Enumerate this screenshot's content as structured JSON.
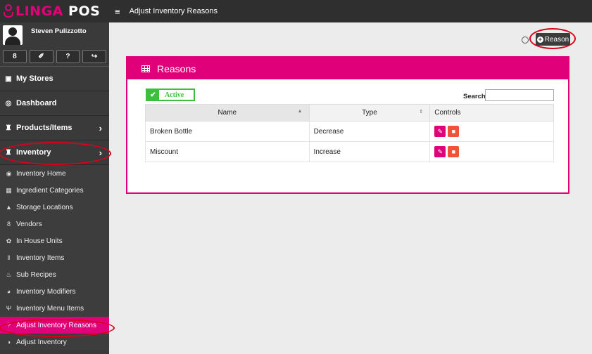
{
  "app": {
    "logo_part1": "LINGA",
    "logo_part2": "POS"
  },
  "user": {
    "name": "Steven Pulizzotto",
    "actions": [
      {
        "icon": "user-icon",
        "glyph": "8"
      },
      {
        "icon": "wrench-icon",
        "glyph": "✐"
      },
      {
        "icon": "help-icon",
        "glyph": "?"
      },
      {
        "icon": "logout-icon",
        "glyph": "↪"
      }
    ]
  },
  "sidebar": {
    "main_items": [
      {
        "label": "My Stores",
        "icon": "store-icon",
        "glyph": "▣"
      },
      {
        "label": "Dashboard",
        "icon": "dashboard-icon",
        "glyph": "◎"
      },
      {
        "label": "Products/Items",
        "icon": "products-icon",
        "glyph": "♜",
        "chevron": "›"
      },
      {
        "label": "Inventory",
        "icon": "inventory-icon",
        "glyph": "♜",
        "chevron": "›"
      }
    ],
    "sub_items": [
      {
        "label": "Inventory Home",
        "icon": "home-icon",
        "glyph": "◉"
      },
      {
        "label": "Ingredient Categories",
        "icon": "categories-icon",
        "glyph": "▦"
      },
      {
        "label": "Storage Locations",
        "icon": "flask-icon",
        "glyph": "▲"
      },
      {
        "label": "Vendors",
        "icon": "vendor-icon",
        "glyph": "8"
      },
      {
        "label": "In House Units",
        "icon": "units-icon",
        "glyph": "✿"
      },
      {
        "label": "Inventory Items",
        "icon": "items-icon",
        "glyph": "‖"
      },
      {
        "label": "Sub Recipes",
        "icon": "recipes-icon",
        "glyph": "♨"
      },
      {
        "label": "Inventory Modifiers",
        "icon": "modifiers-icon",
        "glyph": "◕"
      },
      {
        "label": "Inventory Menu Items",
        "icon": "menu-items-icon",
        "glyph": "Ψ"
      },
      {
        "label": "Adjust Inventory Reasons",
        "icon": "question-icon",
        "glyph": "?",
        "active": true
      },
      {
        "label": "Adjust Inventory",
        "icon": "adjust-icon",
        "glyph": "◑"
      }
    ]
  },
  "topbar": {
    "menu_glyph": "≡",
    "title": "Adjust Inventory Reasons"
  },
  "toolbar": {
    "reason_button": "Reason"
  },
  "panel": {
    "title": "Reasons",
    "status_filter": "Active",
    "search_label": "Search",
    "search_value": "",
    "columns": [
      "Name",
      "Type",
      "Controls"
    ],
    "rows": [
      {
        "name": "Broken Bottle",
        "type": "Decrease"
      },
      {
        "name": "Miscount",
        "type": "Increase"
      }
    ]
  },
  "colors": {
    "brand": "#e0007a",
    "delete": "#f0523a",
    "active_green": "#3cbf3c",
    "highlight_ring": "#d9001c"
  }
}
